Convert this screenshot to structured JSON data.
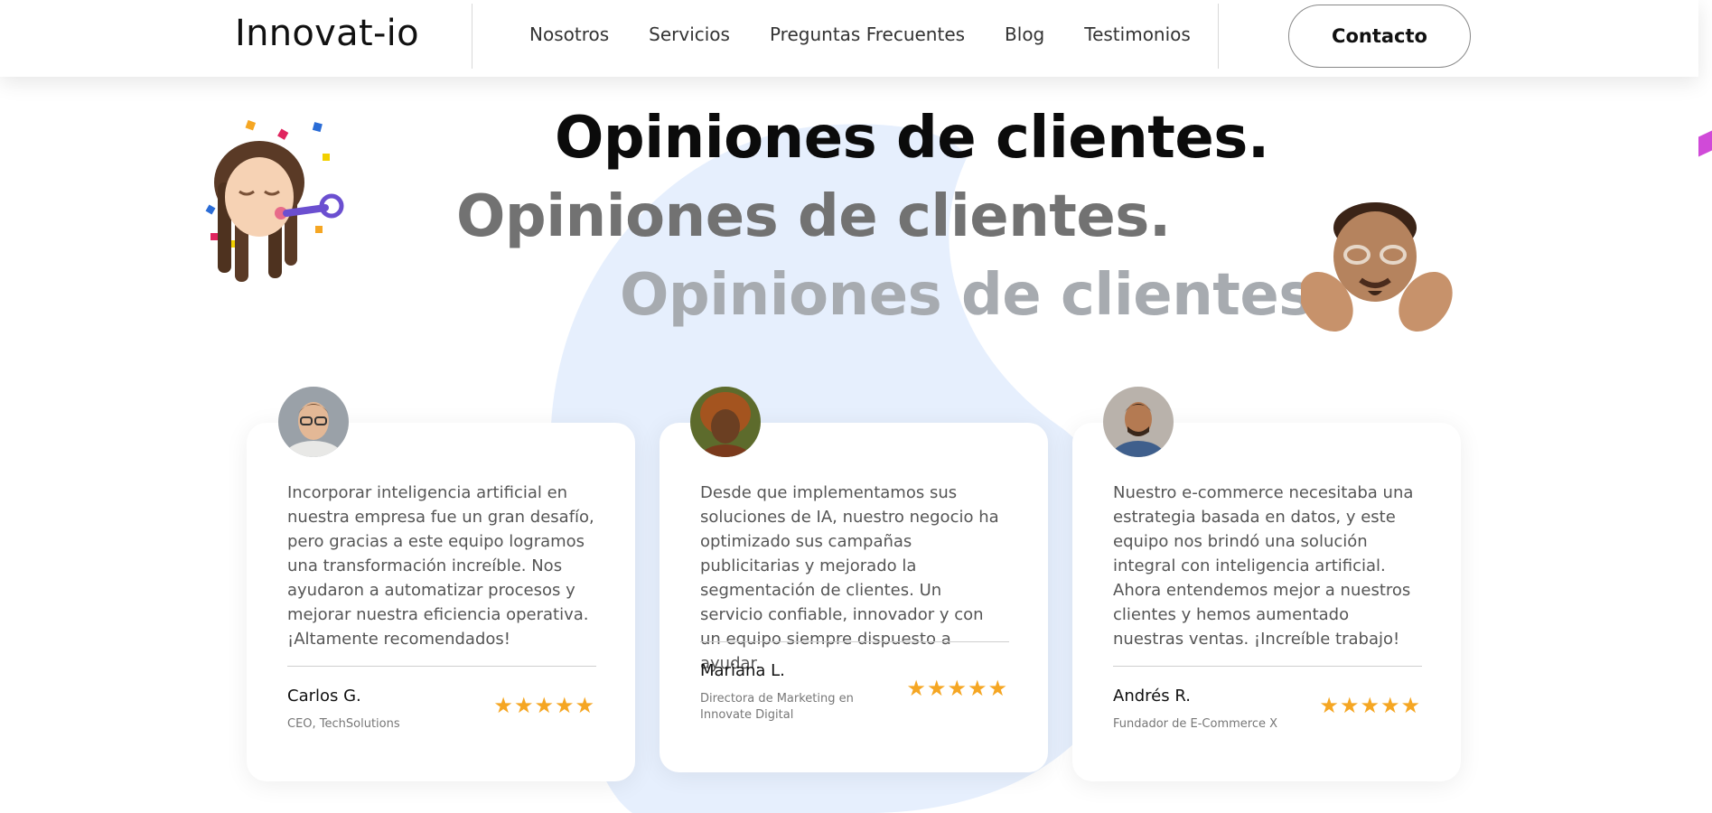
{
  "header": {
    "logo": "Innovat-io",
    "nav": [
      "Nosotros",
      "Servicios",
      "Preguntas Frecuentes",
      "Blog",
      "Testimonios"
    ],
    "contact_label": "Contacto"
  },
  "headlines": [
    "Opiniones de clientes.",
    "Opiniones de clientes.",
    "Opiniones de clientes."
  ],
  "testimonials": [
    {
      "quote": "Incorporar inteligencia artificial en nuestra empresa fue un gran desafío, pero gracias a este equipo logramos una transformación increíble. Nos ayudaron a automatizar procesos y mejorar nuestra eficiencia operativa. ¡Altamente recomendados!",
      "name": "Carlos G.",
      "role": "CEO, TechSolutions",
      "rating": 5
    },
    {
      "quote": "Desde que implementamos sus soluciones de IA, nuestro negocio ha optimizado sus campañas publicitarias y mejorado la segmentación de clientes. Un servicio confiable, innovador y con un equipo siempre dispuesto a ayudar.",
      "name": "Mariana L.",
      "role": "Directora de Marketing en Innovate Digital",
      "rating": 5
    },
    {
      "quote": "Nuestro e-commerce necesitaba una estrategia basada en datos, y este equipo nos brindó una solución integral con inteligencia artificial. Ahora entendemos mejor a nuestros clientes y hemos aumentado nuestras ventas. ¡Increíble trabajo!",
      "name": "Andrés R.",
      "role": "Fundador de E-Commerce X",
      "rating": 5
    }
  ],
  "colors": {
    "blob": "#e6effd",
    "star": "#f5a623",
    "headline_primary": "#0b0b0b",
    "headline_secondary": "#727272",
    "headline_tertiary": "#a7abb0"
  }
}
